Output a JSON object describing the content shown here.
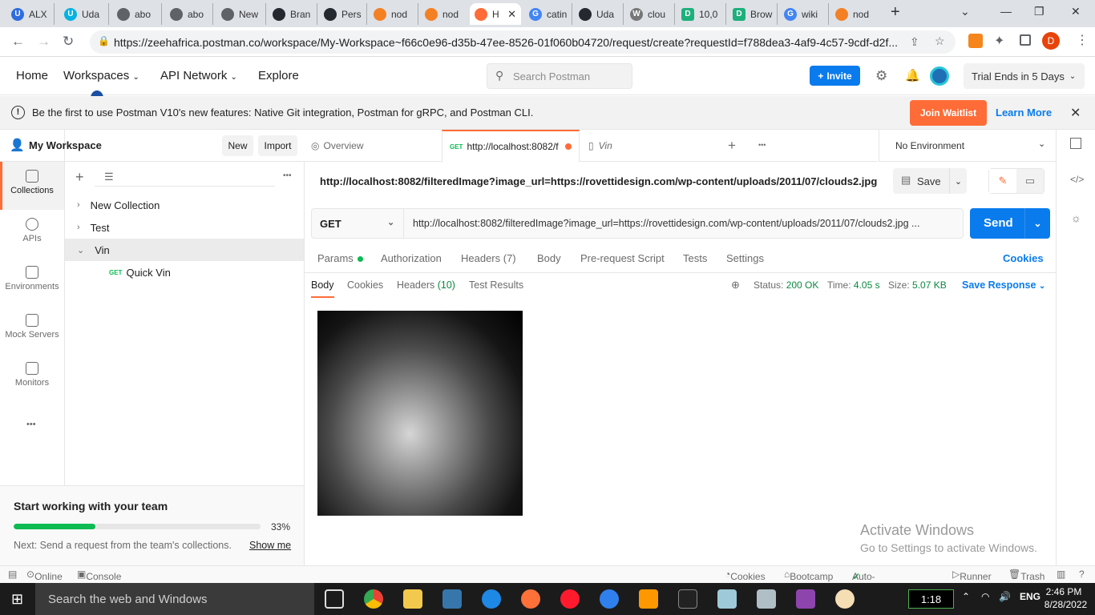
{
  "browser": {
    "tabs": [
      {
        "label": "ALX",
        "color": "#2e6cdf"
      },
      {
        "label": "Uda",
        "color": "#02b3e4"
      },
      {
        "label": "abo",
        "color": "#5f6368"
      },
      {
        "label": "abo",
        "color": "#5f6368"
      },
      {
        "label": "New",
        "color": "#5f6368"
      },
      {
        "label": "Bran",
        "color": "#24292f"
      },
      {
        "label": "Pers",
        "color": "#24292f"
      },
      {
        "label": "nod",
        "color": "#f48024"
      },
      {
        "label": "nod",
        "color": "#f48024"
      },
      {
        "label": "H",
        "color": "#ff6c37"
      },
      {
        "label": "catin",
        "color": "#4285f4"
      },
      {
        "label": "Uda",
        "color": "#24292f"
      },
      {
        "label": "clou",
        "color": "#777777"
      },
      {
        "label": "10,0",
        "color": "#1db07c"
      },
      {
        "label": "Brow",
        "color": "#1db07c"
      },
      {
        "label": "wiki",
        "color": "#4285f4"
      },
      {
        "label": "nod",
        "color": "#f48024"
      }
    ],
    "new_tab": "+",
    "url": "https://zeehafrica.postman.co/workspace/My-Workspace~f66c0e96-d35b-47ee-8526-01f060b04720/request/create?requestId=f788dea3-4af9-4c57-9cdf-d2f...",
    "profile_initial": "D"
  },
  "header": {
    "nav": [
      "Home",
      "Workspaces",
      "API Network",
      "Explore"
    ],
    "search_placeholder": "Search Postman",
    "invite": "Invite",
    "trial": "Trial Ends in 5 Days"
  },
  "banner": {
    "text": "Be the first to use Postman V10's new features: Native Git integration, Postman for gRPC, and Postman CLI.",
    "join": "Join Waitlist",
    "learn": "Learn More"
  },
  "sidebar": {
    "workspace": "My Workspace",
    "new_btn": "New",
    "import_btn": "Import",
    "icons": [
      "Collections",
      "APIs",
      "Environments",
      "Mock Servers",
      "Monitors"
    ],
    "more": "•••",
    "collections": [
      {
        "name": "New Collection"
      },
      {
        "name": "Test"
      },
      {
        "name": "Vin"
      }
    ],
    "request": {
      "method": "GET",
      "name": "Quick Vin"
    }
  },
  "onboarding": {
    "title": "Start working with your team",
    "percent_text": "33%",
    "progress": 0.33,
    "next": "Next: Send a request from the team's collections.",
    "show_me": "Show me"
  },
  "request_tabs": {
    "overview": "Overview",
    "active_method": "GET",
    "active_label": "http://localhost:8082/f",
    "vin": "Vin",
    "environment": "No Environment"
  },
  "request": {
    "title": "http://localhost:8082/filteredImage?image_url=https://rovettidesign.com/wp-content/uploads/2011/07/clouds2.jpg",
    "save": "Save",
    "method": "GET",
    "url": "http://localhost:8082/filteredImage?image_url=https://rovettidesign.com/wp-content/uploads/2011/07/clouds2.jpg ...",
    "send": "Send",
    "tabs": [
      "Params",
      "Authorization",
      "Headers (7)",
      "Body",
      "Pre-request Script",
      "Tests",
      "Settings"
    ],
    "cookies": "Cookies"
  },
  "response": {
    "tabs": [
      "Body",
      "Cookies",
      "Headers",
      "Test Results"
    ],
    "headers_count": "(10)",
    "status_label": "Status:",
    "status": "200 OK",
    "time_label": "Time:",
    "time": "4.05 s",
    "size_label": "Size:",
    "size": "5.07 KB",
    "save_response": "Save Response"
  },
  "watermark": {
    "line1": "Activate Windows",
    "line2": "Go to Settings to activate Windows."
  },
  "statusbar": {
    "online": "Online",
    "console": "Console",
    "cookies": "Cookies",
    "bootcamp": "Bootcamp",
    "autoselect": "Auto-select agent",
    "runner": "Runner",
    "trash": "Trash"
  },
  "taskbar": {
    "search": "Search the web and Windows",
    "clock_badge": "1:18",
    "time": "2:46 PM",
    "date": "8/28/2022"
  },
  "colors": {
    "accent": "#ff6c37",
    "primary": "#097bed",
    "success": "#0cbb52",
    "status_ok": "#0a8a3e"
  }
}
